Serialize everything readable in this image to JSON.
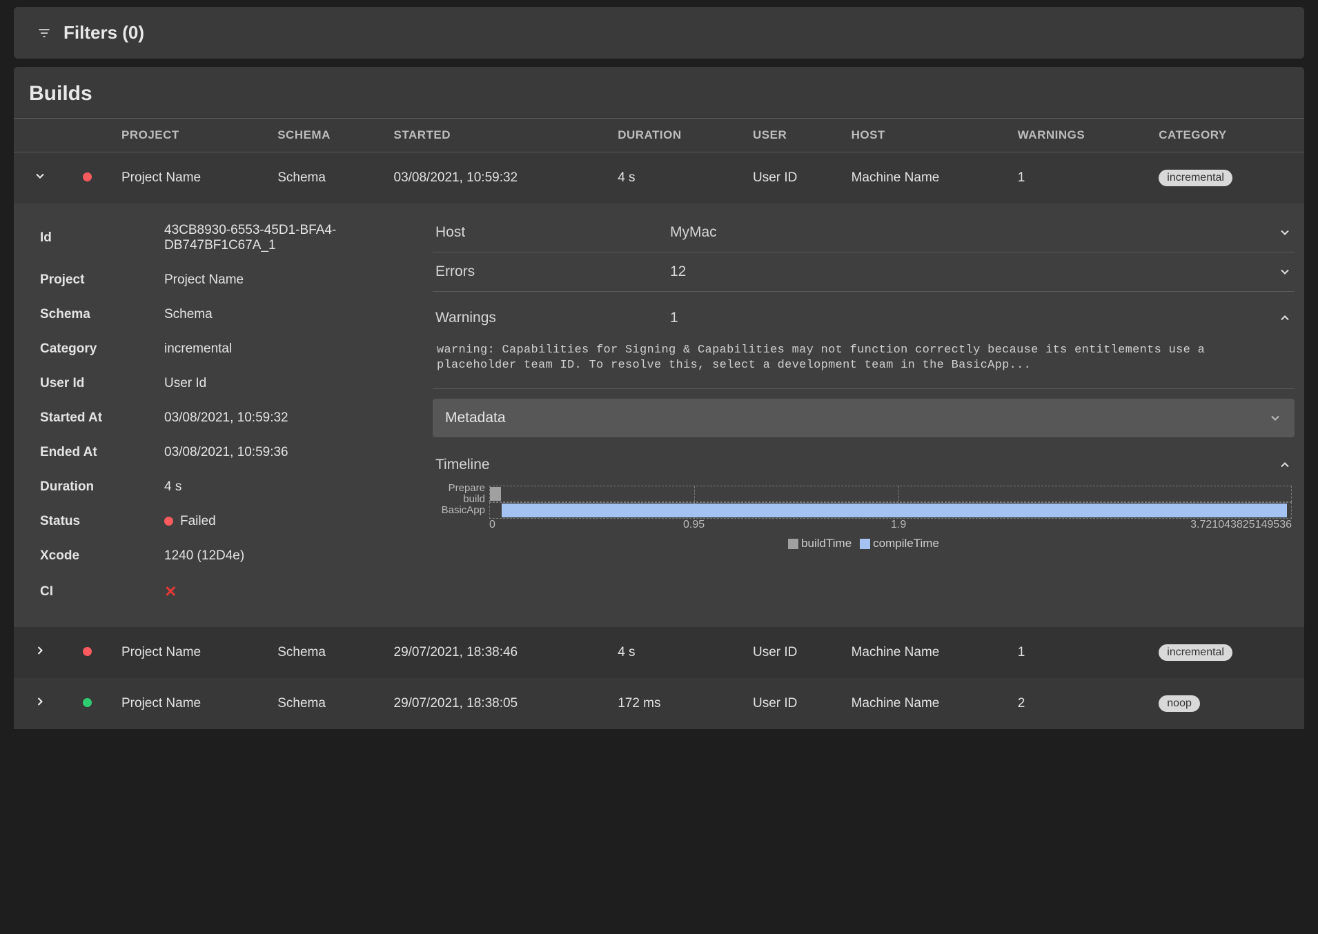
{
  "filters": {
    "title": "Filters (0)"
  },
  "builds": {
    "title": "Builds",
    "columns": {
      "project": "PROJECT",
      "schema": "SCHEMA",
      "started": "STARTED",
      "duration": "DURATION",
      "user": "USER",
      "host": "HOST",
      "warnings": "WARNINGS",
      "category": "CATEGORY"
    },
    "rows": [
      {
        "expanded": true,
        "status": "failed",
        "project": "Project Name",
        "schema": "Schema",
        "started": "03/08/2021, 10:59:32",
        "duration": "4 s",
        "user": "User ID",
        "host": "Machine Name",
        "warnings": "1",
        "category": "incremental"
      },
      {
        "expanded": false,
        "status": "failed",
        "project": "Project Name",
        "schema": "Schema",
        "started": "29/07/2021, 18:38:46",
        "duration": "4 s",
        "user": "User ID",
        "host": "Machine Name",
        "warnings": "1",
        "category": "incremental"
      },
      {
        "expanded": false,
        "status": "success",
        "project": "Project Name",
        "schema": "Schema",
        "started": "29/07/2021, 18:38:05",
        "duration": "172 ms",
        "user": "User ID",
        "host": "Machine Name",
        "warnings": "2",
        "category": "noop"
      }
    ]
  },
  "detail": {
    "kv": {
      "id_k": "Id",
      "id_v": "43CB8930-6553-45D1-BFA4-DB747BF1C67A_1",
      "project_k": "Project",
      "project_v": "Project Name",
      "schema_k": "Schema",
      "schema_v": "Schema",
      "category_k": "Category",
      "category_v": "incremental",
      "userid_k": "User Id",
      "userid_v": "User Id",
      "started_k": "Started At",
      "started_v": "03/08/2021, 10:59:32",
      "ended_k": "Ended At",
      "ended_v": "03/08/2021, 10:59:36",
      "duration_k": "Duration",
      "duration_v": "4 s",
      "status_k": "Status",
      "status_v": "Failed",
      "xcode_k": "Xcode",
      "xcode_v": "1240 (12D4e)",
      "ci_k": "CI"
    },
    "sections": {
      "host_label": "Host",
      "host_value": "MyMac",
      "errors_label": "Errors",
      "errors_value": "12",
      "warnings_label": "Warnings",
      "warnings_value": "1",
      "warning_text": "warning: Capabilities for Signing & Capabilities may not function correctly because its entitlements use a placeholder team ID. To resolve this, select a development team in the BasicApp...",
      "metadata_label": "Metadata",
      "timeline_label": "Timeline"
    }
  },
  "chart_data": {
    "type": "bar",
    "orientation": "horizontal",
    "xlabel": "",
    "ylabel": "",
    "xlim": [
      0,
      3.721043825149536
    ],
    "ticks": [
      0,
      0.95,
      1.9,
      3.721043825149536
    ],
    "categories": [
      "Prepare build",
      "BasicApp"
    ],
    "series": [
      {
        "name": "buildTime",
        "values": [
          0.05,
          3.7
        ],
        "color": "#a0a0a0"
      },
      {
        "name": "compileTime",
        "values": [
          0.0,
          3.7
        ],
        "color": "#a4c3f3"
      }
    ],
    "axis_labels": {
      "t0": "0",
      "t1": "0.95",
      "t2": "1.9",
      "t3": "3.721043825149536"
    },
    "legend": {
      "a": "buildTime",
      "b": "compileTime"
    }
  }
}
